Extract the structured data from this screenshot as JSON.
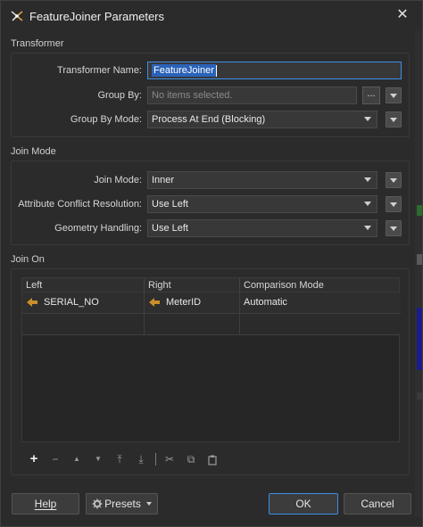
{
  "window": {
    "title": "FeatureJoiner Parameters",
    "close_glyph": "✕"
  },
  "transformer": {
    "section_label": "Transformer",
    "name_label": "Transformer Name:",
    "name_value": "FeatureJoiner",
    "group_by_label": "Group By:",
    "group_by_placeholder": "No items selected.",
    "group_by_button": "...",
    "group_by_mode_label": "Group By Mode:",
    "group_by_mode_value": "Process At End (Blocking)"
  },
  "join_mode": {
    "section_label": "Join Mode",
    "join_mode_label": "Join Mode:",
    "join_mode_value": "Inner",
    "conflict_label": "Attribute Conflict Resolution:",
    "conflict_value": "Use Left",
    "geometry_label": "Geometry Handling:",
    "geometry_value": "Use Left"
  },
  "join_on": {
    "section_label": "Join On",
    "columns": [
      "Left",
      "Right",
      "Comparison Mode"
    ],
    "rows": [
      {
        "left": "SERIAL_NO",
        "right": "MeterID",
        "mode": "Automatic"
      }
    ]
  },
  "toolbar": {
    "add": "+",
    "remove": "−",
    "move_up": "▲",
    "move_down": "▼",
    "move_top": "⤒",
    "move_bottom": "⤓",
    "cut": "✂",
    "copy": "⧉",
    "paste": "📋"
  },
  "footer": {
    "help": "Help",
    "presets": "Presets",
    "ok": "OK",
    "cancel": "Cancel"
  },
  "colors": {
    "background": "#2b2b2b",
    "accent": "#3d8ee8",
    "selection": "#2a62b8",
    "attribute_icon": "#c8902a"
  }
}
